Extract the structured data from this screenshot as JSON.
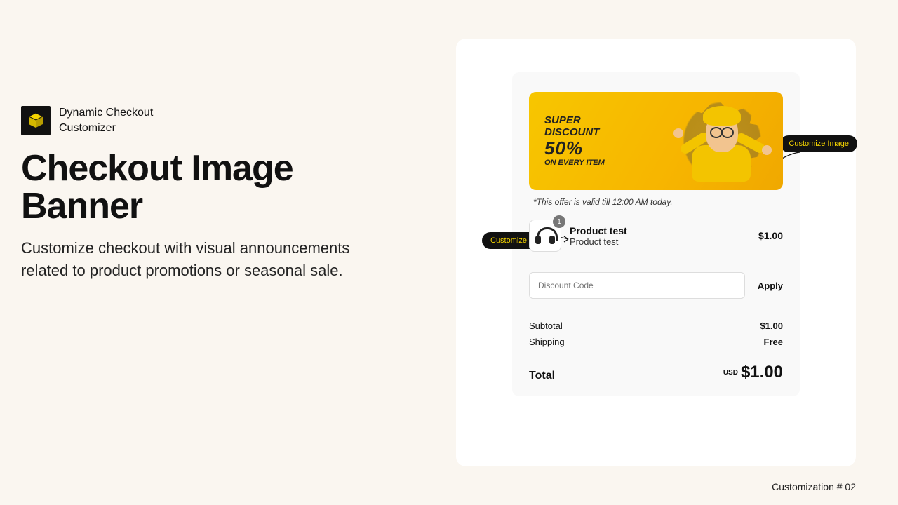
{
  "brand": {
    "line1": "Dynamic Checkout",
    "line2": "Customizer"
  },
  "headline": "Checkout Image Banner",
  "subcopy": "Customize checkout with visual announcements related to product promotions or seasonal sale.",
  "banner": {
    "line1": "SUPER",
    "line2": "DISCOUNT",
    "percent": "50%",
    "line4": "ON EVERY ITEM",
    "caption": "*This offer is valid till 12:00 AM today."
  },
  "annotations": {
    "image": "Customize Image",
    "text": "Customize Text"
  },
  "product": {
    "qty": "1",
    "name": "Product test",
    "sub": "Product test",
    "price": "$1.00"
  },
  "discount": {
    "placeholder": "Discount Code",
    "apply": "Apply"
  },
  "summary": {
    "subtotal_label": "Subtotal",
    "subtotal_value": "$1.00",
    "shipping_label": "Shipping",
    "shipping_value": "Free",
    "total_label": "Total",
    "currency": "USD",
    "total_value": "$1.00"
  },
  "footer": "Customization # 02"
}
